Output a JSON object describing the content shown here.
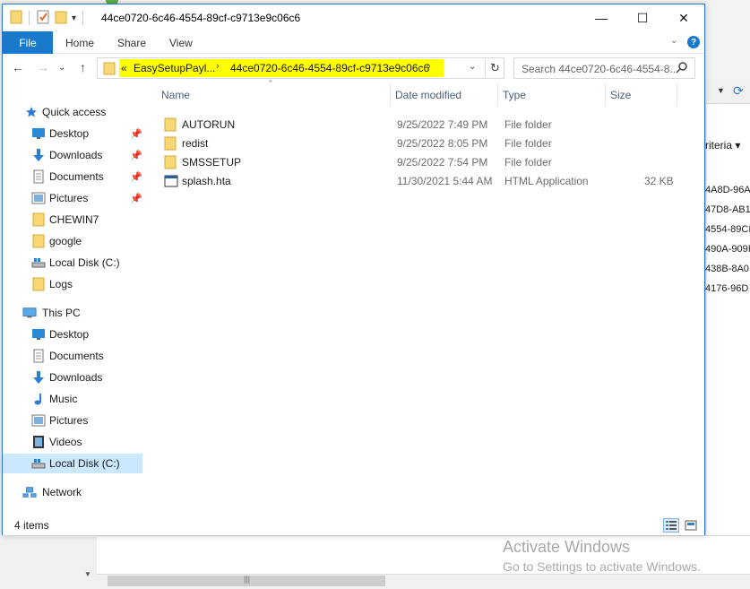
{
  "window": {
    "title": "44ce0720-6c46-4554-89cf-c9713e9c06c6",
    "minimize": "—",
    "maximize": "☐",
    "close": "✕"
  },
  "ribbon": {
    "tabs": [
      "File",
      "Home",
      "Share",
      "View"
    ],
    "help": "?"
  },
  "navigation": {
    "back": "←",
    "forward": "→",
    "recent": "⌄",
    "up": "↑"
  },
  "address": {
    "overflow": "«",
    "crumbs": [
      "EasySetupPayl...",
      "44ce0720-6c46-4554-89cf-c9713e9c06c6"
    ],
    "highlight_color": "#ffff00"
  },
  "search": {
    "placeholder": "Search 44ce0720-6c46-4554-8..."
  },
  "sidebar": {
    "items": [
      {
        "label": "Quick access",
        "icon": "star-icon"
      },
      {
        "label": "Desktop",
        "icon": "desktop-icon",
        "pinned": true
      },
      {
        "label": "Downloads",
        "icon": "download-icon",
        "pinned": true
      },
      {
        "label": "Documents",
        "icon": "documents-icon",
        "pinned": true
      },
      {
        "label": "Pictures",
        "icon": "pictures-icon",
        "pinned": true
      },
      {
        "label": "CHEWIN7",
        "icon": "folder-icon"
      },
      {
        "label": "google",
        "icon": "folder-icon"
      },
      {
        "label": "Local Disk (C:)",
        "icon": "drive-icon"
      },
      {
        "label": "Logs",
        "icon": "folder-icon"
      },
      {
        "label": "This PC",
        "icon": "computer-icon"
      },
      {
        "label": "Desktop",
        "icon": "desktop-icon"
      },
      {
        "label": "Documents",
        "icon": "documents-icon"
      },
      {
        "label": "Downloads",
        "icon": "download-icon"
      },
      {
        "label": "Music",
        "icon": "music-icon"
      },
      {
        "label": "Pictures",
        "icon": "pictures-icon"
      },
      {
        "label": "Videos",
        "icon": "videos-icon"
      },
      {
        "label": "Local Disk (C:)",
        "icon": "drive-icon",
        "selected": true
      },
      {
        "label": "Network",
        "icon": "network-icon"
      }
    ]
  },
  "columns": {
    "name": "Name",
    "date": "Date modified",
    "type": "Type",
    "size": "Size"
  },
  "files": [
    {
      "name": "AUTORUN",
      "date": "9/25/2022 7:49 PM",
      "type": "File folder",
      "size": "",
      "icon": "folder-icon"
    },
    {
      "name": "redist",
      "date": "9/25/2022 8:05 PM",
      "type": "File folder",
      "size": "",
      "icon": "folder-icon"
    },
    {
      "name": "SMSSETUP",
      "date": "9/25/2022 7:54 PM",
      "type": "File folder",
      "size": "",
      "icon": "folder-icon"
    },
    {
      "name": "splash.hta",
      "date": "11/30/2021 5:44 AM",
      "type": "HTML Application",
      "size": "32 KB",
      "icon": "hta-file-icon"
    }
  ],
  "status": {
    "item_count": "4 items"
  },
  "background": {
    "criteria": "riteria ▾",
    "guids": [
      "4A8D-96A",
      "47D8-AB1",
      "4554-89CI",
      "490A-909I",
      "438B-8A0",
      "4176-96D"
    ],
    "activate_title": "Activate Windows",
    "activate_sub": "Go to Settings to activate Windows.",
    "scroll_grip": "|||"
  },
  "colors": {
    "accent": "#1979ca",
    "selection": "#cce8ff",
    "folder": "#f8d775"
  }
}
